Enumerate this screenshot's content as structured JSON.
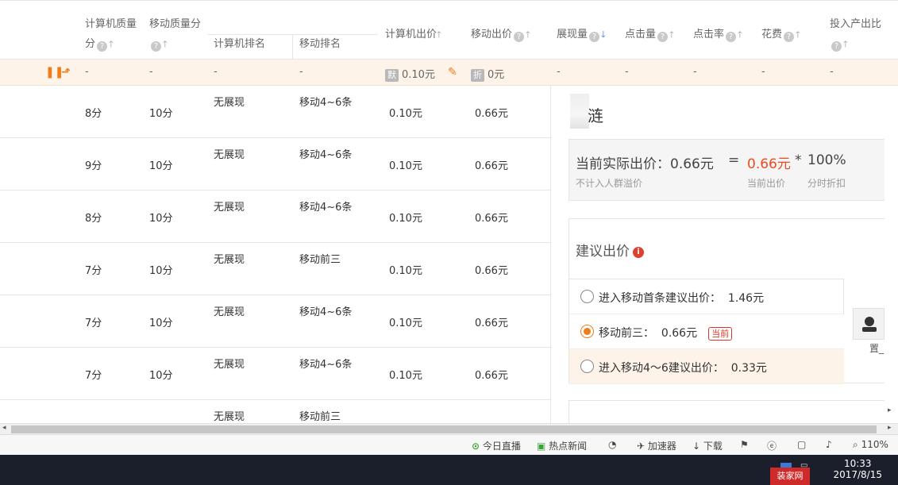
{
  "header": {
    "pc_quality": "计算机质量",
    "pc_quality_sub": "分",
    "mobile_quality": "移动质量分",
    "pc_rank": "计算机排名",
    "mobile_rank": "移动排名",
    "pc_bid": "计算机出价",
    "mobile_bid": "移动出价",
    "impressions": "展现量",
    "clicks": "点击量",
    "ctr": "点击率",
    "cost": "花费",
    "roi": "投入产出比"
  },
  "summary": {
    "pc_quality": "-",
    "mobile_quality": "-",
    "pc_rank": "-",
    "mobile_rank": "-",
    "pc_tag": "默",
    "pc_bid": "0.10元",
    "mobile_tag": "折",
    "mobile_bid": "0元",
    "impressions": "-",
    "clicks": "-",
    "ctr": "-",
    "cost": "-",
    "roi": "-"
  },
  "rows": [
    {
      "pc_quality": "8分",
      "mobile_quality": "10分",
      "pc_rank": "无展现",
      "mobile_rank": "移动4~6条",
      "pc_bid": "0.10元",
      "mobile_bid": "0.66元"
    },
    {
      "pc_quality": "9分",
      "mobile_quality": "10分",
      "pc_rank": "无展现",
      "mobile_rank": "移动4~6条",
      "pc_bid": "0.10元",
      "mobile_bid": "0.66元"
    },
    {
      "pc_quality": "8分",
      "mobile_quality": "10分",
      "pc_rank": "无展现",
      "mobile_rank": "移动4~6条",
      "pc_bid": "0.10元",
      "mobile_bid": "0.66元"
    },
    {
      "pc_quality": "7分",
      "mobile_quality": "10分",
      "pc_rank": "无展现",
      "mobile_rank": "移动前三",
      "pc_bid": "0.10元",
      "mobile_bid": "0.66元"
    },
    {
      "pc_quality": "7分",
      "mobile_quality": "10分",
      "pc_rank": "无展现",
      "mobile_rank": "移动4~6条",
      "pc_bid": "0.10元",
      "mobile_bid": "0.66元"
    },
    {
      "pc_quality": "7分",
      "mobile_quality": "10分",
      "pc_rank": "无展现",
      "mobile_rank": "移动4~6条",
      "pc_bid": "0.10元",
      "mobile_bid": "0.66元"
    },
    {
      "pc_quality": "",
      "mobile_quality": "",
      "pc_rank": "无展现",
      "mobile_rank": "移动前三",
      "pc_bid": "",
      "mobile_bid": ""
    }
  ],
  "panel": {
    "name": "涟",
    "actual_label": "当前实际出价：",
    "actual_value": "0.66元",
    "equals": "=",
    "current_value": "0.66元",
    "times": "*",
    "discount": "100%",
    "note_crowd": "不计入人群溢价",
    "note_current": "当前出价",
    "note_discount": "分时折扣",
    "suggest_title": "建议出价",
    "options": [
      {
        "label": "进入移动首条建议出价：",
        "value": "1.46元",
        "selected": false
      },
      {
        "label": "移动前三：",
        "value": "0.66元",
        "selected": true,
        "badge": "当前"
      },
      {
        "label": "进入移动4～6建议出价：",
        "value": "0.33元",
        "selected": false
      }
    ],
    "side_text": "置_"
  },
  "statusbar": {
    "live": "今日直播",
    "news": "热点新闻",
    "accel": "加速器",
    "download": "下载",
    "zoom": "110%"
  },
  "taskbar": {
    "time": "10:33",
    "date": "2017/8/15",
    "watermark": "装家网"
  },
  "colors": {
    "accent_orange": "#ef7d1a",
    "price_red": "#ef4a1f",
    "selected_bg": "#fdf3e8"
  }
}
